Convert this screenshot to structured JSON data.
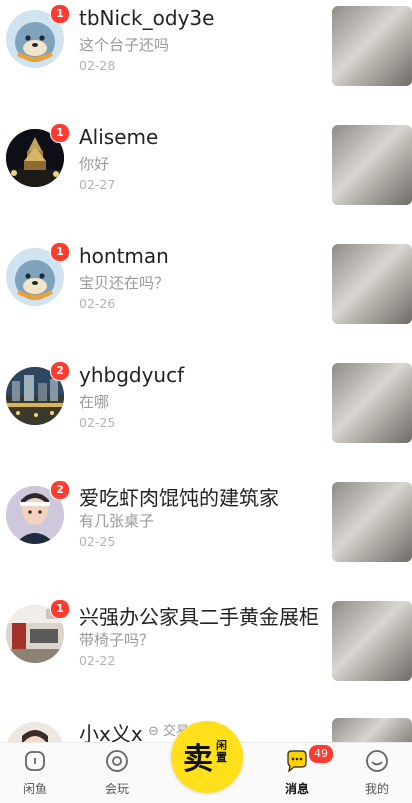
{
  "conversations": [
    {
      "name": "tbNick_ody3e",
      "message": "这个台子还吗",
      "date": "02-28",
      "unread": "1",
      "avatar": "seal-avatar"
    },
    {
      "name": "Aliseme",
      "message": "你好",
      "date": "02-27",
      "unread": "1",
      "avatar": "night-temple-avatar"
    },
    {
      "name": "hontman",
      "message": "宝贝还在吗？",
      "date": "02-26",
      "unread": "1",
      "avatar": "seal-avatar"
    },
    {
      "name": "yhbgdyucf",
      "message": "在哪",
      "date": "02-25",
      "unread": "2",
      "avatar": "city-avatar"
    },
    {
      "name": "爱吃虾肉馄饨的建筑家",
      "message": "有几张桌子",
      "date": "02-25",
      "unread": "2",
      "avatar": "person-avatar"
    },
    {
      "name": "兴强办公家具二手黄金展柜",
      "message": "带椅子吗？",
      "date": "02-22",
      "unread": "1",
      "avatar": "office-avatar"
    },
    {
      "name": "小x义x",
      "message": "",
      "date": "",
      "unread": "",
      "avatar": "person-avatar",
      "tag": "交易"
    }
  ],
  "tabbar": {
    "home_label": "闲鱼",
    "play_label": "会玩",
    "sell_big": "卖",
    "sell_small": "闲置",
    "messages_label": "消息",
    "messages_badge": "49",
    "mine_label": "我的"
  },
  "colors": {
    "badge": "#ff3b30",
    "sell": "#ffe01a",
    "messages_icon": "#ffd100"
  }
}
